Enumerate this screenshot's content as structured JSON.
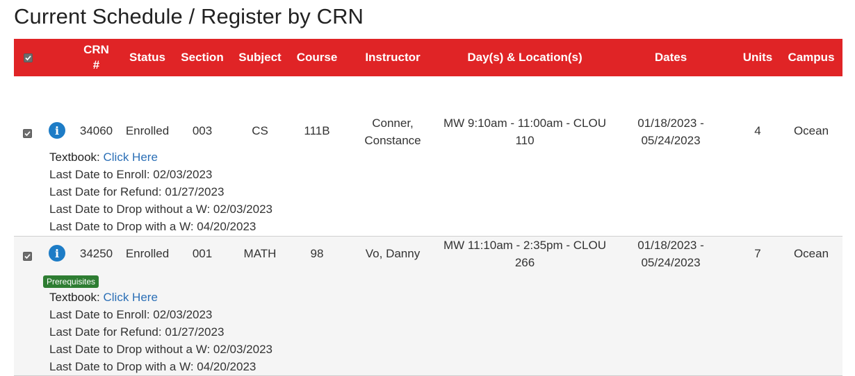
{
  "page": {
    "title": "Current Schedule / Register by CRN"
  },
  "table": {
    "headers": {
      "crn": "CRN #",
      "status": "Status",
      "section": "Section",
      "subject": "Subject",
      "course": "Course",
      "instructor": "Instructor",
      "days_locations": "Day(s) & Location(s)",
      "dates": "Dates",
      "units": "Units",
      "campus": "Campus"
    },
    "rows": [
      {
        "crn": "34060",
        "status": "Enrolled",
        "section": "003",
        "subject": "CS",
        "course": "111B",
        "instructor_line1": "Conner,",
        "instructor_line2": "Constance",
        "days_line1": "MW 9:10am - 11:00am - CLOU",
        "days_line2": "110",
        "dates_line1": "01/18/2023 -",
        "dates_line2": "05/24/2023",
        "units": "4",
        "campus": "Ocean",
        "textbook_label": "Textbook:",
        "textbook_link": "Click Here",
        "last_enroll": "Last Date to Enroll: 02/03/2023",
        "last_refund": "Last Date for Refund: 01/27/2023",
        "last_drop_no_w": "Last Date to Drop without a W: 02/03/2023",
        "last_drop_w": "Last Date to Drop with a W: 04/20/2023"
      },
      {
        "crn": "34250",
        "status": "Enrolled",
        "section": "001",
        "subject": "MATH",
        "course": "98",
        "instructor_line1": "Vo, Danny",
        "days_line1": "MW 11:10am - 2:35pm - CLOU",
        "days_line2": "266",
        "dates_line1": "01/18/2023 -",
        "dates_line2": "05/24/2023",
        "units": "7",
        "campus": "Ocean",
        "badge": "Prerequisites",
        "textbook_label": "Textbook:",
        "textbook_link": "Click Here",
        "last_enroll": "Last Date to Enroll: 02/03/2023",
        "last_refund": "Last Date for Refund: 01/27/2023",
        "last_drop_no_w": "Last Date to Drop without a W: 02/03/2023",
        "last_drop_w": "Last Date to Drop with a W: 04/20/2023"
      }
    ]
  },
  "colors": {
    "header_bg": "#e02426",
    "link": "#2b6fb6",
    "badge_bg": "#2e7d32",
    "info_icon": "#1d7cc6"
  },
  "icons": {
    "row_info": "info-icon",
    "select": "checkbox-checked-icon"
  },
  "state": {
    "select_all_checked": true,
    "row1_checked": true,
    "row2_checked": true
  }
}
